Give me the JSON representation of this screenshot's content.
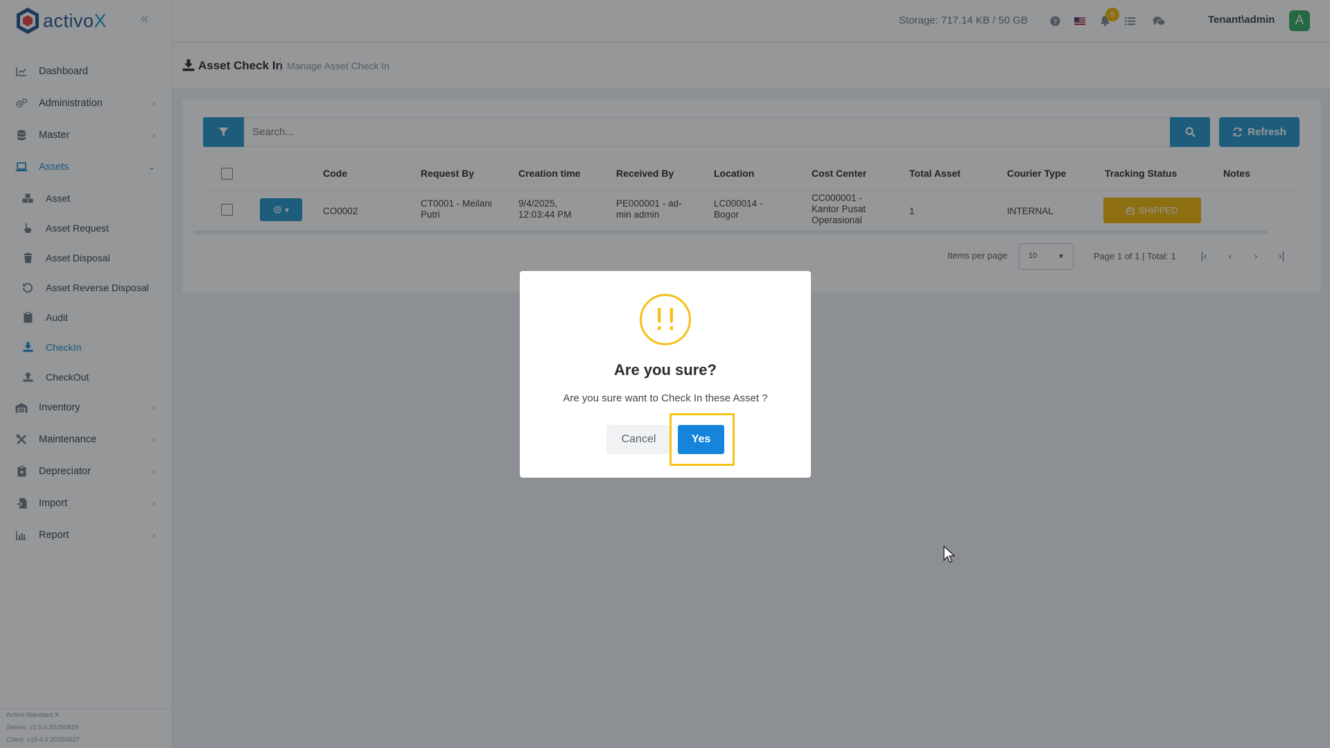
{
  "app": {
    "brand_prefix": "activo",
    "brand_suffix": "X"
  },
  "topbar": {
    "storage": "Storage: 717.14 KB / 50 GB",
    "notification_count": "5",
    "user": "Tenant\\admin",
    "avatar_letter": "A"
  },
  "sidebar": {
    "items": [
      {
        "label": "Dashboard",
        "icon": "chart-line-icon"
      },
      {
        "label": "Administration",
        "icon": "cogs-icon"
      },
      {
        "label": "Master",
        "icon": "database-icon"
      },
      {
        "label": "Assets",
        "icon": "laptop-icon"
      },
      {
        "label": "Inventory",
        "icon": "warehouse-icon"
      },
      {
        "label": "Maintenance",
        "icon": "tools-icon"
      },
      {
        "label": "Depreciator",
        "icon": "clipboard-icon"
      },
      {
        "label": "Import",
        "icon": "file-import-icon"
      },
      {
        "label": "Report",
        "icon": "chart-bar-icon"
      }
    ],
    "asset_children": [
      {
        "label": "Asset"
      },
      {
        "label": "Asset Request"
      },
      {
        "label": "Asset Disposal"
      },
      {
        "label": "Asset Reverse Disposal"
      },
      {
        "label": "Audit"
      },
      {
        "label": "CheckIn"
      },
      {
        "label": "CheckOut"
      }
    ],
    "version": {
      "product": "Activo Standard X",
      "server": "Server: v3.5.0.20250829",
      "client": "Client: v19.4.0.20250827"
    }
  },
  "page": {
    "title": "Asset Check In",
    "subtitle": "Manage Asset Check In"
  },
  "toolbar": {
    "search_placeholder": "Search...",
    "refresh_label": "Refresh"
  },
  "table": {
    "columns": [
      "Code",
      "Request By",
      "Creation time",
      "Received By",
      "Location",
      "Cost Center",
      "Total Asset",
      "Courier Type",
      "Tracking Status",
      "Notes"
    ],
    "rows": [
      {
        "code": "CO0002",
        "request_by_1": "CT0001 - Meilani",
        "request_by_2": "Putri",
        "creation_1": "9/4/2025,",
        "creation_2": "12:03:44 PM",
        "received_1": "PE000001 - ad-",
        "received_2": "min admin",
        "location_1": "LC000014 -",
        "location_2": "Bogor",
        "cost_1": "CC000001 -",
        "cost_2": "Kantor Pusat",
        "cost_3": "Operasional",
        "total": "1",
        "courier": "INTERNAL",
        "status": "SHIPPED",
        "notes": ""
      }
    ]
  },
  "pager": {
    "items_per_page_label": "Items per page",
    "items_per_page": "10",
    "info": "Page 1 of 1 | Total: 1"
  },
  "dialog": {
    "icon": "!!",
    "title": "Are you sure?",
    "text": "Are you sure want to Check In these Asset ?",
    "cancel": "Cancel",
    "confirm": "Yes"
  },
  "colors": {
    "primary": "#1f90c9",
    "warning": "#f0b400",
    "dialog_yes": "#1584db",
    "highlight": "#f7c313"
  }
}
